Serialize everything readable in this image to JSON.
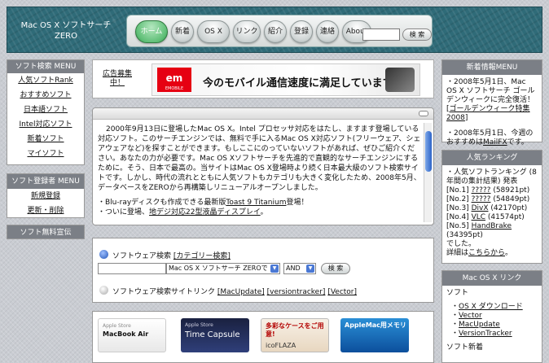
{
  "header": {
    "site_title": "Mac OS X ソフトサーチ ZERO",
    "nav": [
      "ホーム",
      "新着",
      "OS X",
      "リンク",
      "紹介",
      "登録",
      "連絡",
      "About"
    ],
    "search_button": "検 索"
  },
  "left_menu": {
    "title": "ソフト検索 MENU",
    "items": [
      "人気ソフトRank",
      "おすすめソフト",
      "日本語ソフト",
      "Intel対応ソフト",
      "新着ソフト",
      "マイソフト"
    ]
  },
  "registrant_menu": {
    "title": "ソフト登録者 MENU",
    "items": [
      "新規登録",
      "更新・削除"
    ]
  },
  "free_ad": {
    "title": "ソフト無料宣伝"
  },
  "ad": {
    "label": "広告募集中！",
    "logo": "em",
    "logo_sub": "EMOBILE",
    "text": "今のモバイル通信速度に満足していますか?"
  },
  "intro": {
    "paragraph": "2000年9月13日に登場したMac OS X。Intel プロセッサ対応をはたし、ますます登場している対応ソフト。このサーチエンジンでは、無料で手に入るMac OS X対応ソフト(フリーウェア、シェアウェアなど)を探すことができます。もしここにのっていないソフトがあれば、ぜひご紹介ください。あなたの力が必要です。Mac OS Xソフトサーチを先進的で直観的なサーチエンジンにするために。そう、日本で最高の。当サイトはMac OS X登場時より続く日本最大級のソフト検索サイトです。しかし、時代の流れとともに人気ソフトもカテゴリも大きく変化したため、2008年5月、データベースをZEROから再構築しリニューアルオープンしました。",
    "bullet1_pre": "・Blu-rayディスクも作成できる最新版",
    "bullet1_link": "Toast 9 Titanium",
    "bullet1_post": "登場！",
    "bullet2_pre": "・ついに登場、",
    "bullet2_link": "地デジ対応22型液晶ディスプレイ",
    "bullet2_post": "。"
  },
  "search": {
    "label": "ソフトウェア検索",
    "category_link": "[カテゴリー検索]",
    "site_select": "Mac OS X ソフトサーチ ZEROで",
    "op_select": "AND",
    "go_button": "検 索",
    "site_link_label": "ソフトウェア検索サイトリンク",
    "site_links": [
      "[MacUpdate]",
      "[versiontracker]",
      "[Vector]"
    ]
  },
  "banners": [
    {
      "title": "MacBook Air",
      "sub": "Apple Store"
    },
    {
      "title": "Time Capsule",
      "sub": "Apple Store"
    },
    {
      "title": "多彩なケースをご用意!",
      "sub": "icoFLAZA"
    },
    {
      "title": "AppleMac用メモリ",
      "sub": ""
    }
  ],
  "news": {
    "title": "新着情報MENU",
    "item1_pre": "・2008年5月1日、Mac OS X ソフトサーチ ゴールデンウィークに完全復活！[",
    "item1_link": "ゴールデンウィーク特集 2008",
    "item1_post": "]",
    "item2_pre": "・2008年5月1日、今週のおすすめは",
    "item2_link": "MailFX",
    "item2_post": "です。"
  },
  "ranking": {
    "title": "人気ランキング",
    "lines": [
      "・人気ソフトランキング (8年間の集計結果) 発表"
    ],
    "items": [
      {
        "no": "[No.1] ",
        "name": "?????",
        "pts": " (58921pt)"
      },
      {
        "no": "[No.2] ",
        "name": "?????",
        "pts": " (54849pt)"
      },
      {
        "no": "[No.3] ",
        "name": "DivX",
        "pts": " (42170pt)"
      },
      {
        "no": "[No.4] ",
        "name": "VLC",
        "pts": " (41574pt)"
      },
      {
        "no": "[No.5] ",
        "name": "HandBrake",
        "pts": " (34395pt)"
      }
    ],
    "tail": "でした。",
    "detail_pre": "詳細は",
    "detail_link": "こちらから",
    "detail_post": "。"
  },
  "osx_links": {
    "title": "Mac OS X リンク",
    "section": "ソフト",
    "links": [
      "OS X ダウンロード",
      "Vector",
      "MacUpdate",
      "VersionTracker"
    ],
    "section2": "ソフト新着"
  },
  "colors": {
    "header_bg": "#2f6b78",
    "active_nav": "#5fbf77",
    "side_head": "#7b7f86"
  }
}
